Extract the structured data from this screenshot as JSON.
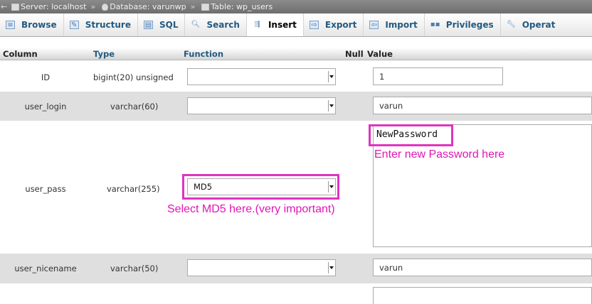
{
  "breadcrumb": {
    "server": "Server: localhost",
    "database": "Database: varunwp",
    "table": "Table: wp_users",
    "separator": "»"
  },
  "tabs": [
    {
      "label": "Browse",
      "icon": "browse-icon"
    },
    {
      "label": "Structure",
      "icon": "structure-icon"
    },
    {
      "label": "SQL",
      "icon": "sql-icon"
    },
    {
      "label": "Search",
      "icon": "search-icon"
    },
    {
      "label": "Insert",
      "icon": "insert-icon",
      "active": true
    },
    {
      "label": "Export",
      "icon": "export-icon"
    },
    {
      "label": "Import",
      "icon": "import-icon"
    },
    {
      "label": "Privileges",
      "icon": "privileges-icon"
    },
    {
      "label": "Operat",
      "icon": "wrench-icon"
    }
  ],
  "columns": {
    "column": "Column",
    "type": "Type",
    "function": "Function",
    "null": "Null",
    "value": "Value"
  },
  "rows": [
    {
      "name": "ID",
      "type": "bigint(20) unsigned",
      "function": "",
      "value": "1"
    },
    {
      "name": "user_login",
      "type": "varchar(60)",
      "function": "",
      "value": "varun"
    },
    {
      "name": "user_pass",
      "type": "varchar(255)",
      "function": "MD5",
      "value": "NewPassword"
    },
    {
      "name": "user_nicename",
      "type": "varchar(50)",
      "function": "",
      "value": "varun"
    }
  ],
  "annotations": {
    "password": "Enter new Password here",
    "md5": "Select MD5 here.(very important)"
  },
  "colors": {
    "highlight": "#e033bf",
    "annotation_text": "#e017b5",
    "tab_text": "#235a81"
  }
}
